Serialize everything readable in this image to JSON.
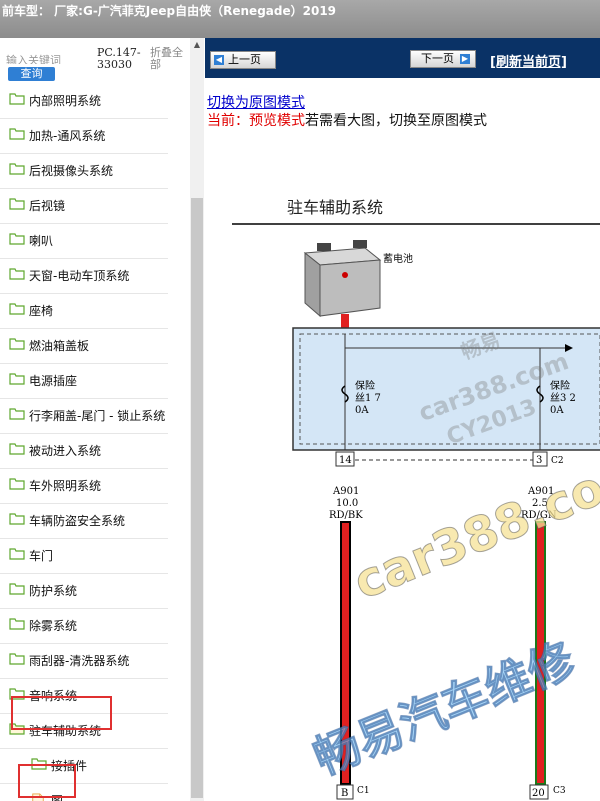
{
  "header": {
    "title": "前车型： 厂家:G-广汽菲克Jeep自由侠（Renegade）2019"
  },
  "sidebar": {
    "search_placeholder": "输入关键词",
    "search_button": "查询",
    "pc_code": "PC.147-33030",
    "fold_all": "折叠全部",
    "items": [
      {
        "label": "内部照明系统"
      },
      {
        "label": "加热-通风系统"
      },
      {
        "label": "后视摄像头系统"
      },
      {
        "label": "后视镜"
      },
      {
        "label": "喇叭"
      },
      {
        "label": "天窗-电动车顶系统"
      },
      {
        "label": "座椅"
      },
      {
        "label": "燃油箱盖板"
      },
      {
        "label": "电源插座"
      },
      {
        "label": "行李厢盖-尾门 - 锁止系统"
      },
      {
        "label": "被动进入系统"
      },
      {
        "label": "车外照明系统"
      },
      {
        "label": "车辆防盗安全系统"
      },
      {
        "label": "车门"
      },
      {
        "label": "防护系统"
      },
      {
        "label": "除雾系统"
      },
      {
        "label": "雨刮器-清洗器系统"
      },
      {
        "label": "音响系统"
      },
      {
        "label": "驻车辅助系统"
      },
      {
        "label": "接插件"
      },
      {
        "label": "图"
      }
    ]
  },
  "main": {
    "prev_label": "上一页",
    "next_label": "下一页",
    "refresh_label": "[刷新当前页]",
    "switch_link": "切换为原图模式",
    "current_prefix": "当前：预览模式",
    "current_suffix": "若需看大图，切换至原图模式",
    "diagram": {
      "title": "驻车辅助系统",
      "battery_label": "蓄电池",
      "fuse1_label": "保险",
      "fuse1_num": "丝1 7",
      "fuse1_amp": "0A",
      "fuse2_label": "保险",
      "fuse2_num": "丝3 2",
      "fuse2_amp": "0A",
      "pin1": "14",
      "pin2": "3",
      "c_top": "C2",
      "wire1_code": "A901",
      "wire1_size": "10.0",
      "wire1_color": "RD/BK",
      "wire2_code": "A901",
      "wire2_size": "2.5",
      "wire2_color": "RD/GN",
      "bottom_pin1": "B",
      "bottom_c1": "C1",
      "bottom_pin2": "20",
      "bottom_c3": "C3"
    },
    "watermarks": [
      "畅易",
      "car388.com",
      "CY2013",
      "car388.com",
      "畅易汽车维修"
    ]
  }
}
